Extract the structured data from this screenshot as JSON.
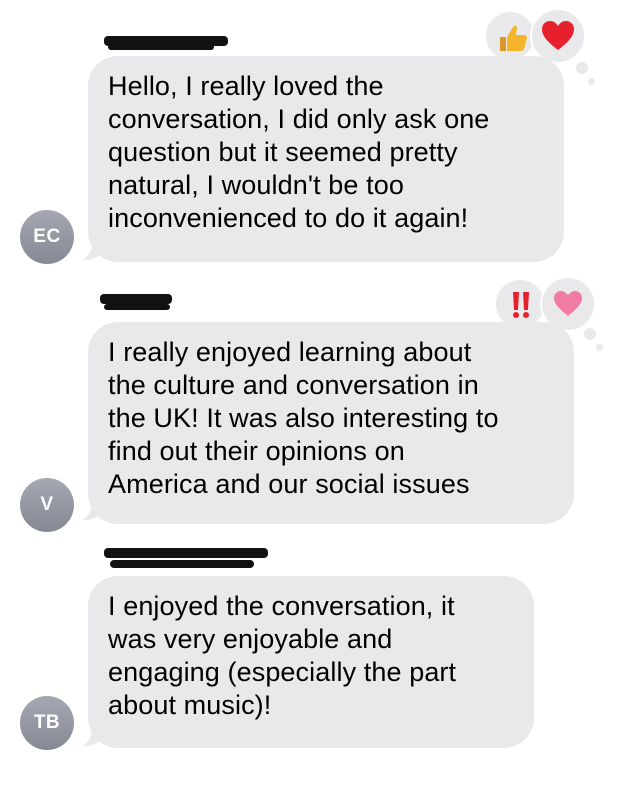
{
  "messages": [
    {
      "avatar_initials": "EC",
      "text": "Hello, I really loved the\nconversation, I did only ask one\nquestion but it seemed pretty\nnatural, I wouldn't be too\ninconvenienced to do it again!",
      "reactions": [
        "thumbs-up",
        "heart"
      ]
    },
    {
      "avatar_initials": "V",
      "text": "I really enjoyed learning about\nthe culture and conversation in\nthe UK! It was also interesting to\nfind out their opinions on\nAmerica and our social issues",
      "reactions": [
        "double-exclamation",
        "pink-heart"
      ]
    },
    {
      "avatar_initials": "TB",
      "text": "I enjoyed the conversation, it\nwas very enjoyable and\nengaging (especially the part\nabout music)!",
      "reactions": []
    }
  ],
  "colors": {
    "bubble": "#e9e9eb",
    "avatar": "#8e919a",
    "heart": "#e8202c",
    "pink_heart": "#f07ca4",
    "thumbs": "#f5b52b",
    "redaction": "#111111"
  }
}
